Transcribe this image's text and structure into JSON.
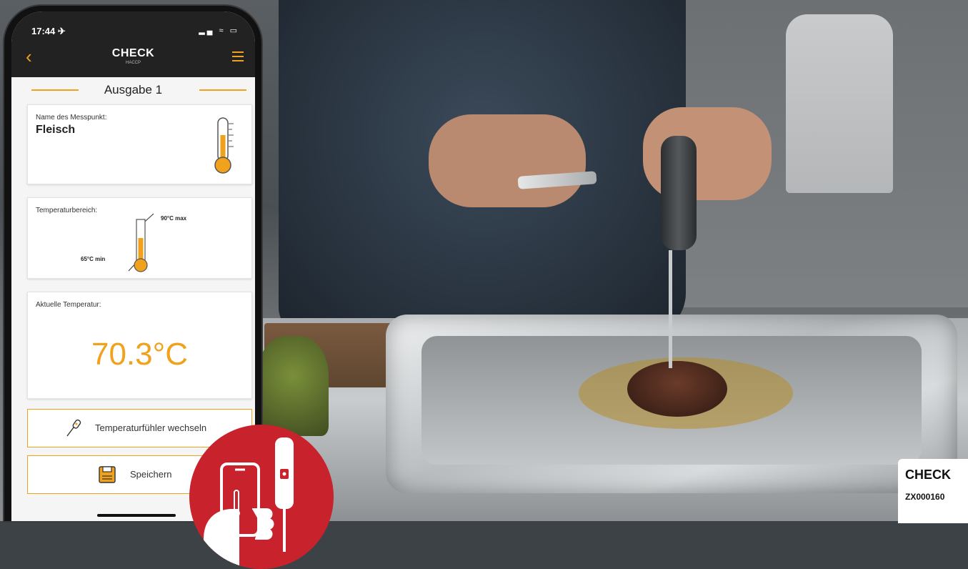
{
  "status_bar": {
    "time": "17:44 ✈",
    "indicators": "▂▄ ≈ ▭"
  },
  "nav": {
    "title": "CHECK",
    "subtitle": "HACCP",
    "back_icon": "chevron-left-icon",
    "menu_icon": "hamburger-icon"
  },
  "section": {
    "title": "Ausgabe 1"
  },
  "measuring_point": {
    "caption": "Name des Messpunkt:",
    "value": "Fleisch"
  },
  "range": {
    "caption": "Temperaturbereich:",
    "max_label": "90°C max",
    "min_label": "65°C min"
  },
  "current": {
    "caption": "Aktuelle Temperatur:",
    "value": "70.3°C"
  },
  "buttons": {
    "change_probe": "Temperaturfühler wechseln",
    "save": "Speichern"
  },
  "corner_label": {
    "line1": "CHECK",
    "line2": "ZX000160"
  },
  "colors": {
    "accent": "#f0a21c",
    "badge": "#c8232c",
    "dark_bar": "#222222"
  }
}
